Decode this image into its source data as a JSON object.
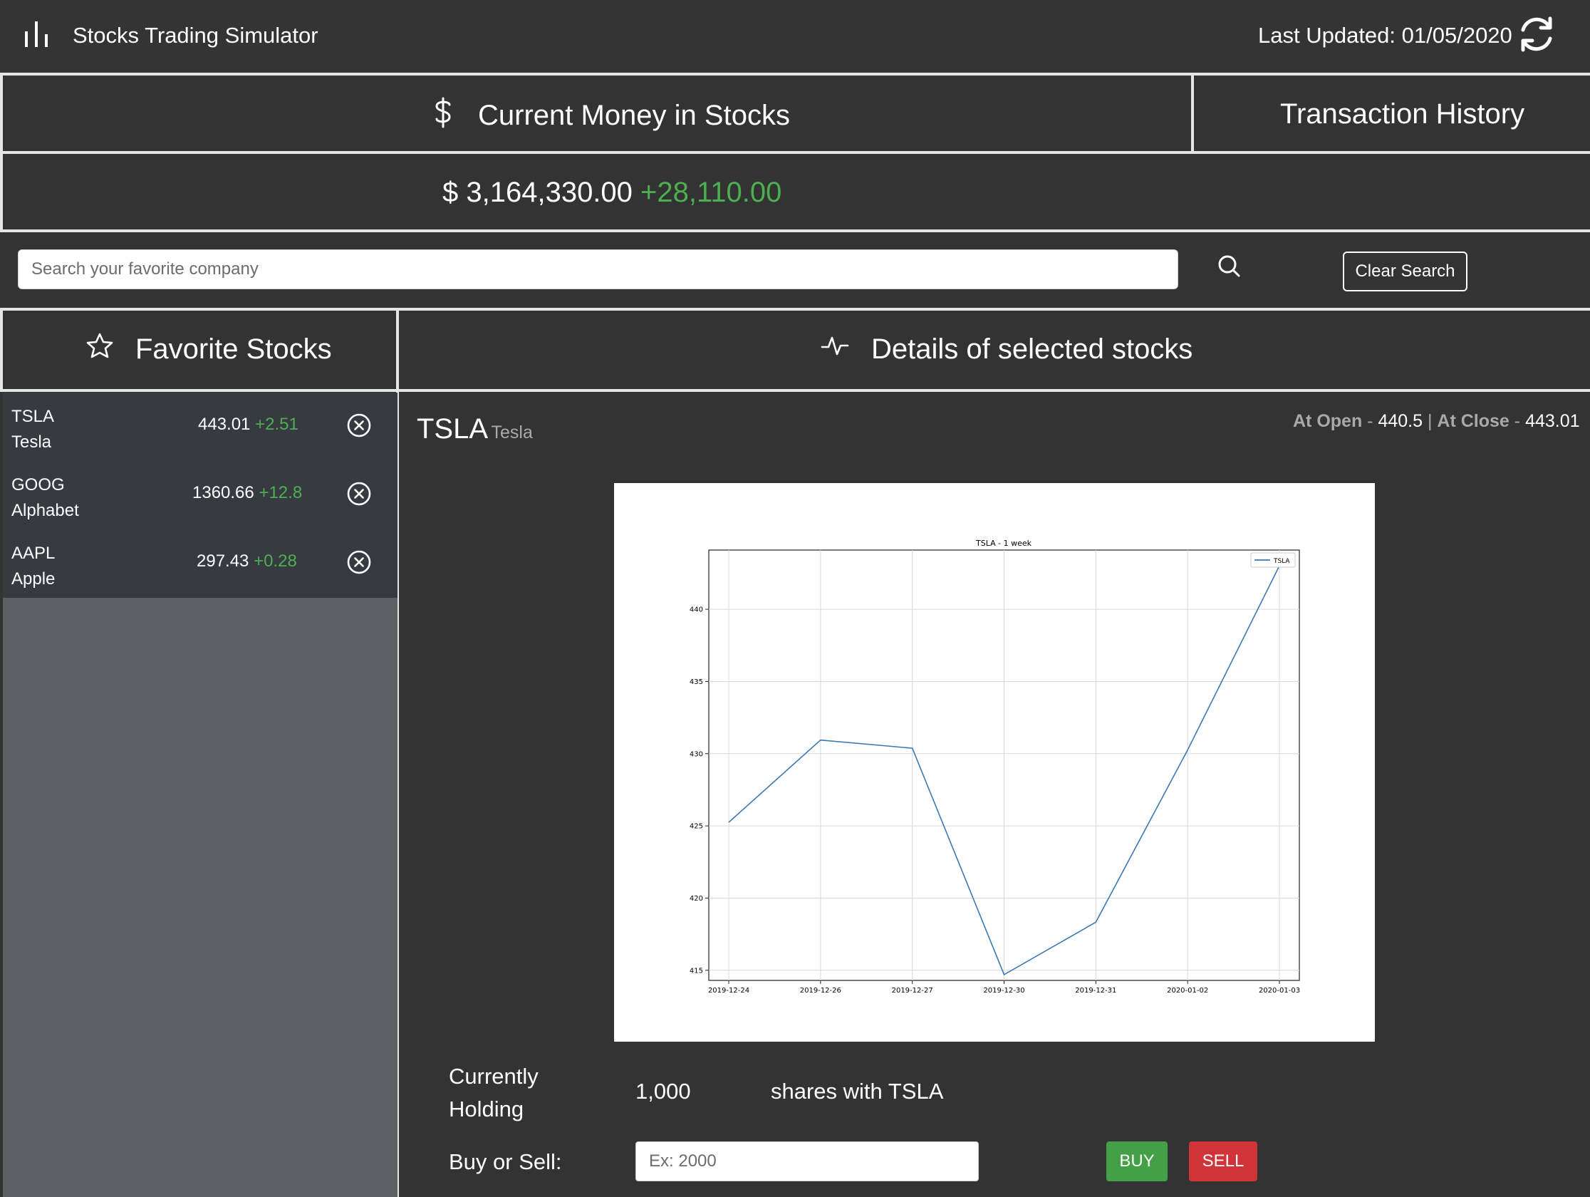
{
  "nav": {
    "title": "Stocks Trading Simulator",
    "last_updated": "Last Updated: 01/05/2020"
  },
  "money": {
    "label": "Current Money in Stocks",
    "transaction_history": "Transaction History",
    "amount": "$ 3,164,330.00",
    "change": "+28,110.00"
  },
  "search": {
    "placeholder": "Search your favorite company",
    "clear_label": "Clear Search"
  },
  "favorites": {
    "title": "Favorite Stocks",
    "items": [
      {
        "symbol": "TSLA",
        "name": "Tesla",
        "price": "443.01",
        "change": "+2.51"
      },
      {
        "symbol": "GOOG",
        "name": "Alphabet",
        "price": "1360.66",
        "change": "+12.8"
      },
      {
        "symbol": "AAPL",
        "name": "Apple",
        "price": "297.43",
        "change": "+0.28"
      }
    ]
  },
  "details": {
    "title": "Details of selected stocks",
    "symbol": "TSLA",
    "company": "Tesla",
    "open_label": "At Open",
    "open_value": "440.5",
    "separator": "|",
    "close_label": "At Close",
    "close_value": "443.01",
    "holding_label_1": "Currently",
    "holding_label_2": "Holding",
    "holding_value": "1,000",
    "holding_suffix": "shares with TSLA",
    "trade_label": "Buy or Sell:",
    "trade_placeholder": "Ex: 2000",
    "buy_label": "BUY",
    "sell_label": "SELL"
  },
  "colors": {
    "background": "#333333",
    "positive": "#4caf50",
    "buy": "#43a047",
    "sell": "#d13438",
    "line": "#3a78b5"
  },
  "chart_data": {
    "type": "line",
    "title": "TSLA - 1 week",
    "categories": [
      "2019-12-24",
      "2019-12-26",
      "2019-12-27",
      "2019-12-30",
      "2019-12-31",
      "2020-01-02",
      "2020-01-03"
    ],
    "series": [
      {
        "name": "TSLA",
        "values": [
          425.25,
          430.94,
          430.38,
          414.7,
          418.33,
          430.26,
          443.01
        ]
      }
    ],
    "ylim": [
      414.3,
      444.1
    ],
    "yticks": [
      415,
      420,
      425,
      430,
      435,
      440
    ],
    "grid": true,
    "legend": "top-right",
    "xlabel": "",
    "ylabel": ""
  }
}
